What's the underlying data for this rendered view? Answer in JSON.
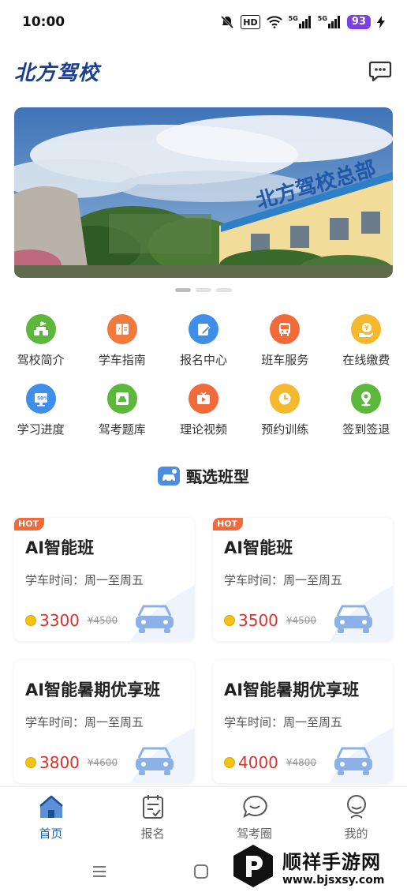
{
  "status_bar": {
    "time": "10:00",
    "battery": "93",
    "network1": "5G",
    "network2": "5G",
    "hd": "HD"
  },
  "header": {
    "brand": "北方驾校",
    "message_icon": "chat-bubble-icon"
  },
  "banner": {
    "sign_text": "北方驾校总部",
    "active_index": 0,
    "count": 3
  },
  "menu": [
    {
      "label": "驾校简介",
      "icon": "school-icon",
      "color": "#5bb83a"
    },
    {
      "label": "学车指南",
      "icon": "guide-icon",
      "color": "#f07a3b"
    },
    {
      "label": "报名中心",
      "icon": "signup-icon",
      "color": "#3f8ee8"
    },
    {
      "label": "班车服务",
      "icon": "bus-icon",
      "color": "#f06a3a"
    },
    {
      "label": "在线缴费",
      "icon": "payment-icon",
      "color": "#f5b82e"
    },
    {
      "label": "学习进度",
      "icon": "progress-icon",
      "color": "#3f8ee8"
    },
    {
      "label": "驾考题库",
      "icon": "question-bank-icon",
      "color": "#5bb83a"
    },
    {
      "label": "理论视频",
      "icon": "video-icon",
      "color": "#f06a3a"
    },
    {
      "label": "预约训练",
      "icon": "appointment-icon",
      "color": "#f5b82e"
    },
    {
      "label": "签到签退",
      "icon": "checkin-icon",
      "color": "#5bb83a"
    }
  ],
  "section": {
    "title": "甄选班型"
  },
  "cards": [
    {
      "hot": "HOT",
      "title": "AI智能班",
      "time": "学车时间：周一至周五",
      "price": "3300",
      "orig": "¥4500"
    },
    {
      "hot": "HOT",
      "title": "AI智能班",
      "time": "学车时间：周一至周五",
      "price": "3500",
      "orig": "¥4500"
    },
    {
      "hot": "",
      "title": "AI智能暑期优享班",
      "time": "学车时间：周一至周五",
      "price": "3800",
      "orig": "¥4600"
    },
    {
      "hot": "",
      "title": "AI智能暑期优享班",
      "time": "学车时间：周一至周五",
      "price": "4000",
      "orig": "¥4800"
    }
  ],
  "tabs": [
    {
      "label": "首页",
      "icon": "home-icon",
      "active": true
    },
    {
      "label": "报名",
      "icon": "clipboard-icon",
      "active": false
    },
    {
      "label": "驾考圈",
      "icon": "chat-circle-icon",
      "active": false
    },
    {
      "label": "我的",
      "icon": "profile-icon",
      "active": false
    }
  ],
  "watermark": {
    "title": "顺祥手游网",
    "url": "www.bjsxsy.com"
  },
  "colors": {
    "brand": "#1b3f8f",
    "price": "#d8332c",
    "hot": "#f26a3a",
    "tab_active": "#1b5fb0"
  }
}
